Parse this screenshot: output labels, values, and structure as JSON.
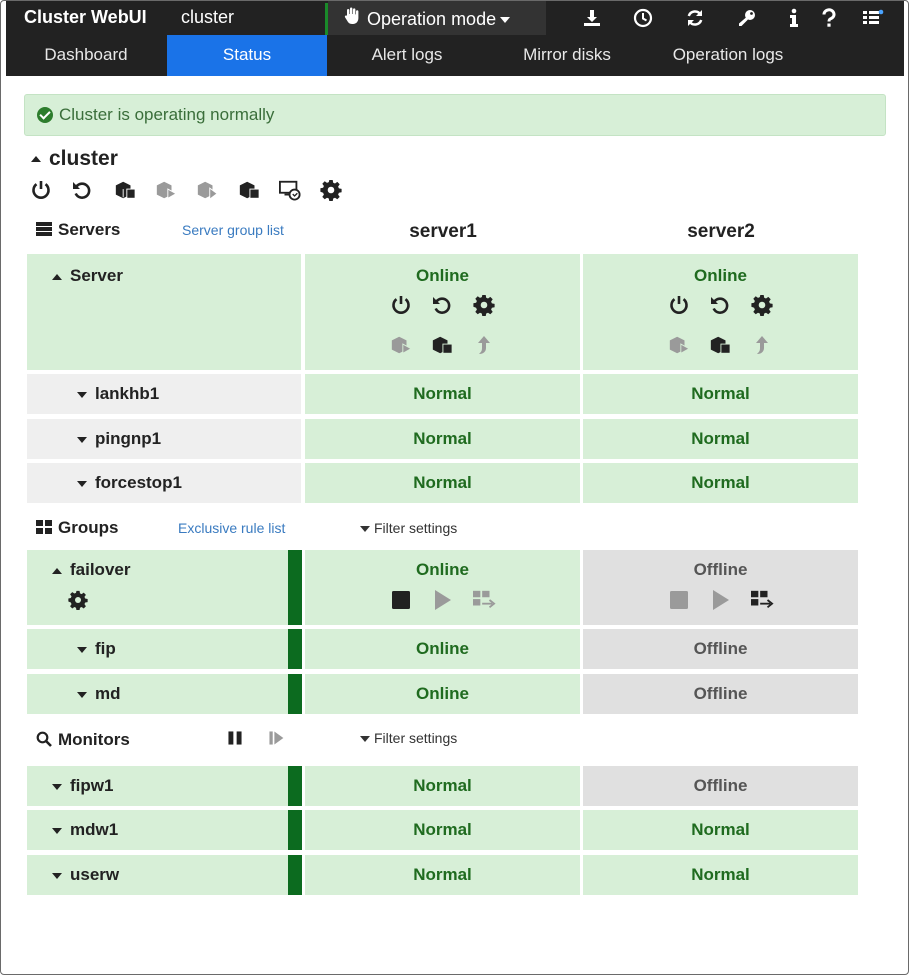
{
  "header": {
    "brand": "Cluster WebUI",
    "cluster_name": "cluster",
    "mode_label": "Operation mode",
    "tabs": [
      {
        "label": "Dashboard",
        "active": false
      },
      {
        "label": "Status",
        "active": true
      },
      {
        "label": "Alert logs",
        "active": false
      },
      {
        "label": "Mirror disks",
        "active": false
      },
      {
        "label": "Operation logs",
        "active": false
      }
    ],
    "tool_icons": [
      "download-icon",
      "clock-icon",
      "refresh-icon",
      "key-icon",
      "info-icon",
      "help-icon",
      "list-icon"
    ]
  },
  "alert": {
    "text": "Cluster is operating normally"
  },
  "cluster": {
    "title": "cluster"
  },
  "servers": {
    "title": "Servers",
    "link": "Server group list",
    "columns": [
      "server1",
      "server2"
    ],
    "server_row_label": "Server",
    "server_status": [
      "Online",
      "Online"
    ],
    "rows": [
      {
        "label": "lankhb1",
        "values": [
          "Normal",
          "Normal"
        ]
      },
      {
        "label": "pingnp1",
        "values": [
          "Normal",
          "Normal"
        ]
      },
      {
        "label": "forcestop1",
        "values": [
          "Normal",
          "Normal"
        ]
      }
    ]
  },
  "groups": {
    "title": "Groups",
    "link": "Exclusive rule list",
    "filter": "Filter settings",
    "group": {
      "label": "failover",
      "values": [
        "Online",
        "Offline"
      ]
    },
    "rows": [
      {
        "label": "fip",
        "values": [
          "Online",
          "Offline"
        ]
      },
      {
        "label": "md",
        "values": [
          "Online",
          "Offline"
        ]
      }
    ]
  },
  "monitors": {
    "title": "Monitors",
    "filter": "Filter settings",
    "rows": [
      {
        "label": "fipw1",
        "values": [
          "Normal",
          "Offline"
        ]
      },
      {
        "label": "mdw1",
        "values": [
          "Normal",
          "Normal"
        ]
      },
      {
        "label": "userw",
        "values": [
          "Normal",
          "Normal"
        ]
      }
    ]
  },
  "colors": {
    "nav_bg": "#222222",
    "active_tab": "#1a73e8",
    "ok_cell": "#d7efd7",
    "offline_cell": "#e0e0e0",
    "status_green": "#1f6b1f",
    "bar_green": "#0c6b1f"
  }
}
